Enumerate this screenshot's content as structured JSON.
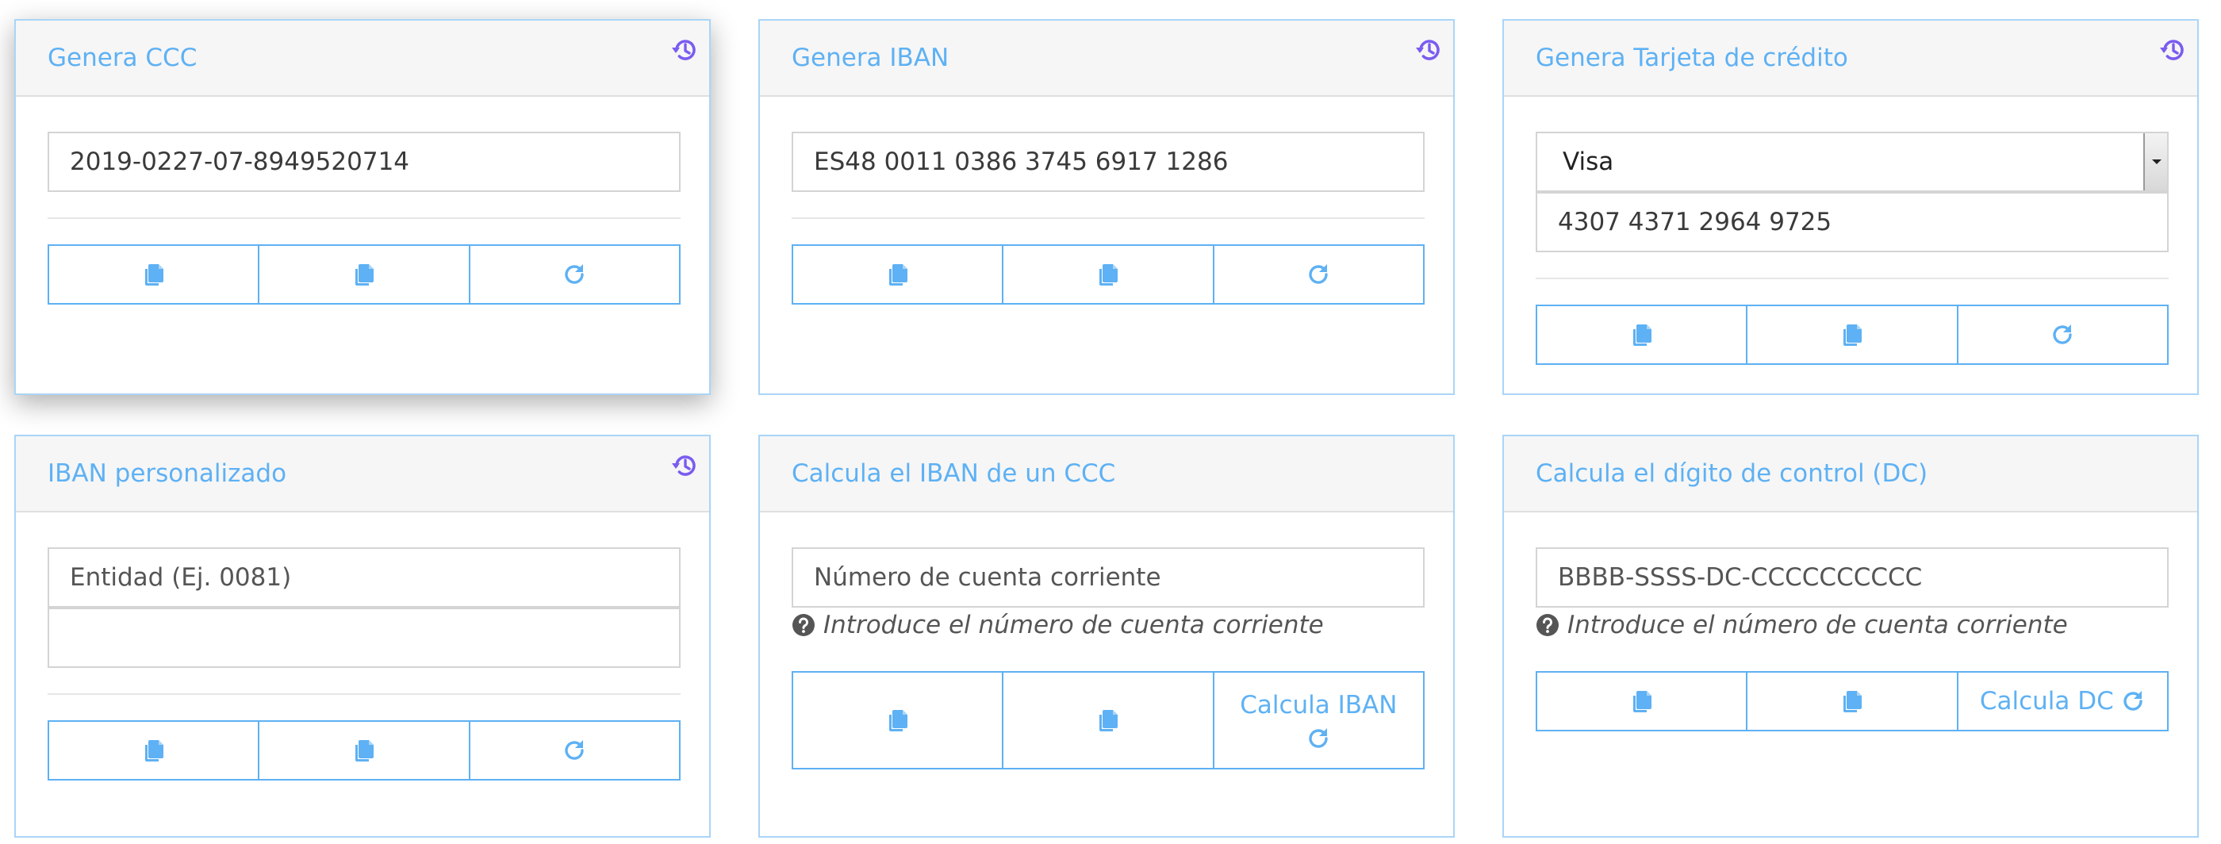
{
  "colors": {
    "accent": "#5eb1f4",
    "history": "#7b5cf0",
    "header_bg": "#f6f6f6"
  },
  "icons": {
    "history": "history-icon",
    "copy": "copy-icon",
    "refresh": "refresh-icon",
    "help": "question-circle-icon"
  },
  "cards": {
    "ccc": {
      "title": "Genera CCC",
      "value": "2019-0227-07-8949520714"
    },
    "iban": {
      "title": "Genera IBAN",
      "value": "ES48 0011 0386 3745 6917 1286"
    },
    "tarjeta": {
      "title": "Genera Tarjeta de crédito",
      "select_value": "Visa",
      "value": "4307 4371 2964 9725"
    },
    "iban_personalizado": {
      "title": "IBAN personalizado",
      "entidad_placeholder": "Entidad (Ej. 0081)",
      "second_value": ""
    },
    "iban_ccc": {
      "title": "Calcula el IBAN de un CCC",
      "placeholder": "Número de cuenta corriente",
      "help": "Introduce el número de cuenta corriente",
      "button": "Calcula IBAN"
    },
    "dc": {
      "title": "Calcula el dígito de control (DC)",
      "placeholder": "BBBB-SSSS-DC-CCCCCCCCCC",
      "help": "Introduce el número de cuenta corriente",
      "button": "Calcula DC"
    }
  }
}
